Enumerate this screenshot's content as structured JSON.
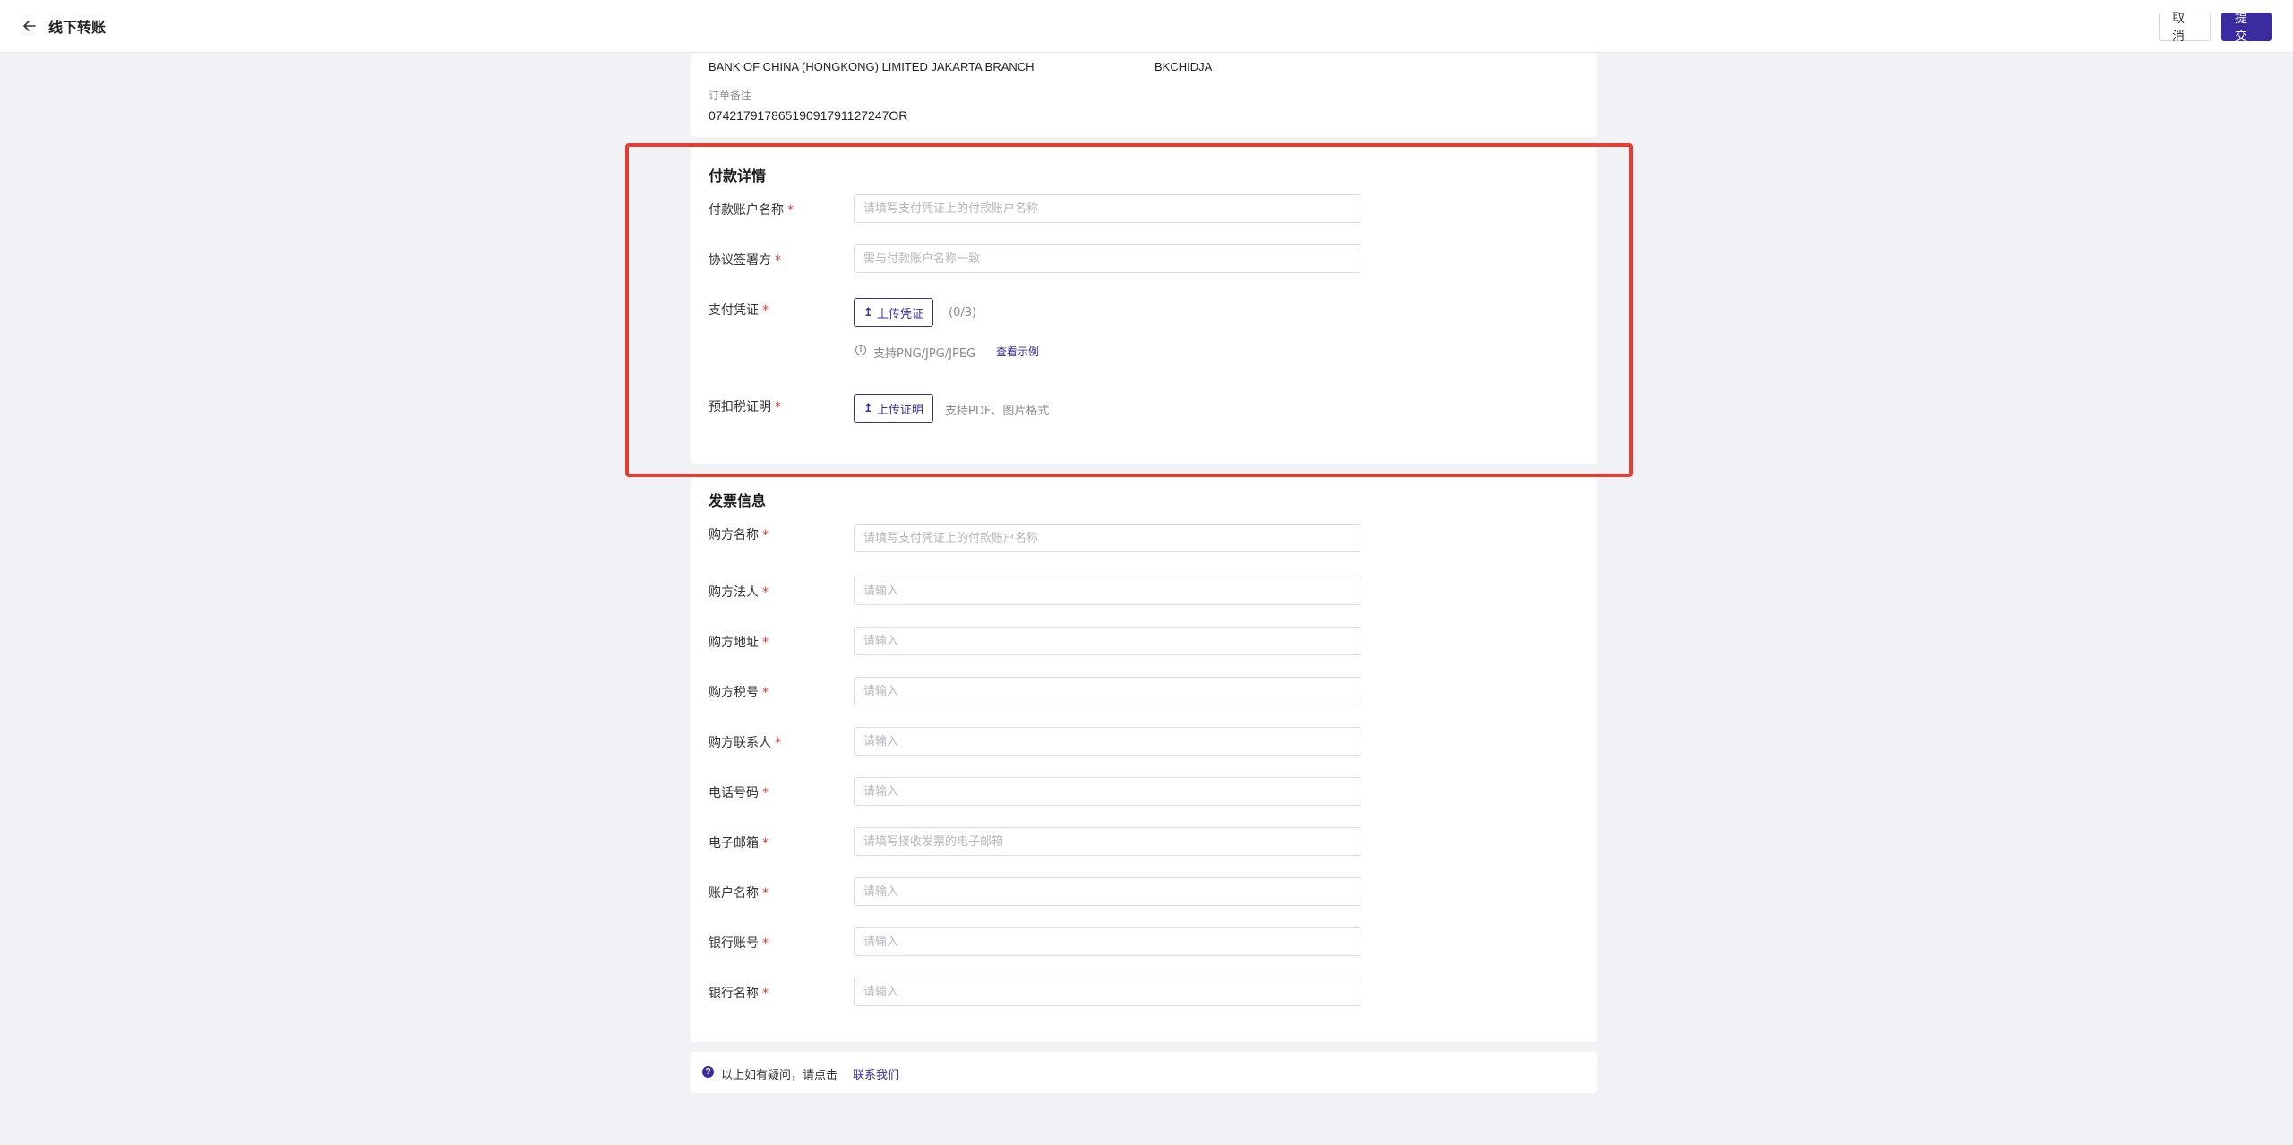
{
  "header": {
    "title": "线下转账",
    "cancel_label": "取消",
    "submit_label": "提交"
  },
  "bank_info": {
    "bank_name": "BANK OF CHINA (HONGKONG) LIMITED JAKARTA BRANCH",
    "swift_code": "BKCHIDJA",
    "remark_label": "订单备注",
    "remark_value": "0742179178651909179112724​7OR"
  },
  "payment": {
    "section_title": "付款详情",
    "payer_name": {
      "label": "付款账户名称",
      "placeholder": "请填写支付凭证上的付款账户名称",
      "value": ""
    },
    "signatory": {
      "label": "协议签署方",
      "placeholder": "需与付款账户名称一致",
      "value": ""
    },
    "voucher": {
      "label": "支付凭证",
      "button_label": "上传凭证",
      "count": "(0/3)",
      "hint": "支持PNG/JPG/JPEG",
      "example_link": "查看示例"
    },
    "tax_cert": {
      "label": "预扣税证明",
      "button_label": "上传证明",
      "hint": "支持PDF、图片格式"
    }
  },
  "invoice": {
    "section_title": "发票信息",
    "fields": [
      {
        "label": "购方名称",
        "placeholder": "请填写支付凭证上的付款账户名称"
      },
      {
        "label": "购方法人",
        "placeholder": "请输入"
      },
      {
        "label": "购方地址",
        "placeholder": "请输入"
      },
      {
        "label": "购方税号",
        "placeholder": "请输入"
      },
      {
        "label": "购方联系人",
        "placeholder": "请输入"
      },
      {
        "label": "电话号码",
        "placeholder": "请输入"
      },
      {
        "label": "电子邮箱",
        "placeholder": "请填写接收发票的电子邮箱"
      },
      {
        "label": "账户名称",
        "placeholder": "请输入"
      },
      {
        "label": "银行账号",
        "placeholder": "请输入"
      },
      {
        "label": "银行名称",
        "placeholder": "请输入"
      }
    ]
  },
  "footer": {
    "help_text": "以上如有疑问，请点击",
    "contact_link": "联系我们"
  },
  "colors": {
    "accent": "#3a2ba0",
    "required": "#e53935",
    "highlight": "#e63c32",
    "background": "#f1f2f5"
  }
}
